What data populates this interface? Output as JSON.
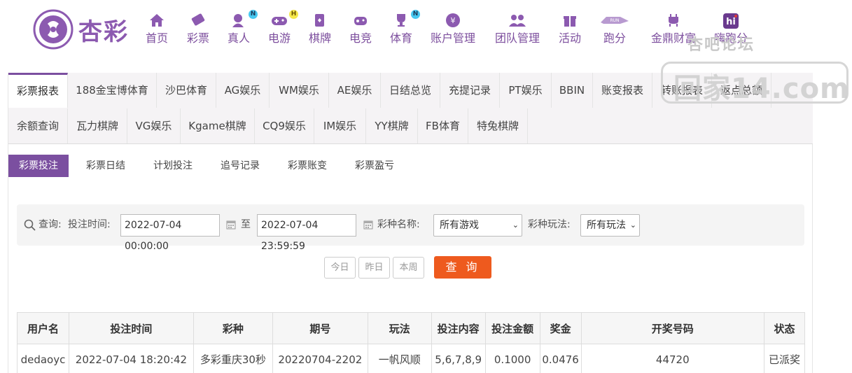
{
  "brand": {
    "name": "杏彩"
  },
  "nav": [
    {
      "label": "首页",
      "icon": "home-icon"
    },
    {
      "label": "彩票",
      "icon": "ticket-icon"
    },
    {
      "label": "真人",
      "icon": "live-dealer-icon",
      "badge": "N"
    },
    {
      "label": "电游",
      "icon": "gamepad-icon",
      "badge": "H"
    },
    {
      "label": "棋牌",
      "icon": "cards-icon"
    },
    {
      "label": "电竞",
      "icon": "esports-icon"
    },
    {
      "label": "体育",
      "icon": "trophy-icon",
      "badge": "N"
    },
    {
      "label": "账户管理",
      "icon": "yen-coin-icon"
    },
    {
      "label": "团队管理",
      "icon": "team-icon"
    },
    {
      "label": "活动",
      "icon": "gift-icon"
    },
    {
      "label": "跑分",
      "icon": "running-score-icon"
    },
    {
      "label": "金鼎财富",
      "icon": "ding-icon"
    },
    {
      "label": "嗨跑分",
      "icon": "hi-icon"
    }
  ],
  "watermark": {
    "top": "杏吧论坛",
    "main": "回家14.com"
  },
  "tabs_row1": [
    "彩票报表",
    "188金宝博体育",
    "沙巴体育",
    "AG娱乐",
    "WM娱乐",
    "AE娱乐",
    "日结总览",
    "充提记录",
    "PT娱乐",
    "BBIN",
    "账变报表",
    "转账报表",
    "返点总额"
  ],
  "tabs_row2": [
    "余额查询",
    "瓦力棋牌",
    "VG娱乐",
    "Kgame棋牌",
    "CQ9娱乐",
    "IM娱乐",
    "YY棋牌",
    "FB体育",
    "特兔棋牌"
  ],
  "subtabs": [
    "彩票投注",
    "彩票日结",
    "计划投注",
    "追号记录",
    "彩票账变",
    "彩票盈亏"
  ],
  "filter": {
    "query_label": "查询:",
    "time_label": "投注时间:",
    "start": "2022-07-04 00:00:00",
    "to": "至",
    "end": "2022-07-04 23:59:59",
    "game_label": "彩种名称:",
    "game_value": "所有游戏",
    "play_label": "彩种玩法:",
    "play_value": "所有玩法"
  },
  "quick": {
    "today": "今日",
    "yesterday": "昨日",
    "week": "本周",
    "search": "查 询"
  },
  "table": {
    "headers": [
      "用户名",
      "投注时间",
      "彩种",
      "期号",
      "玩法",
      "投注内容",
      "投注金额",
      "奖金",
      "开奖号码",
      "状态"
    ],
    "rows": [
      [
        "dedaoyc",
        "2022-07-04 18:20:42",
        "多彩重庆30秒",
        "20220704-2202",
        "一帆风顺",
        "5,6,7,8,9",
        "0.1000",
        "0.0476",
        "44720",
        "已派奖"
      ]
    ]
  },
  "colors": {
    "brand": "#7b4fa0",
    "accent": "#ee5a1e",
    "status_paid": "#e0701c"
  }
}
